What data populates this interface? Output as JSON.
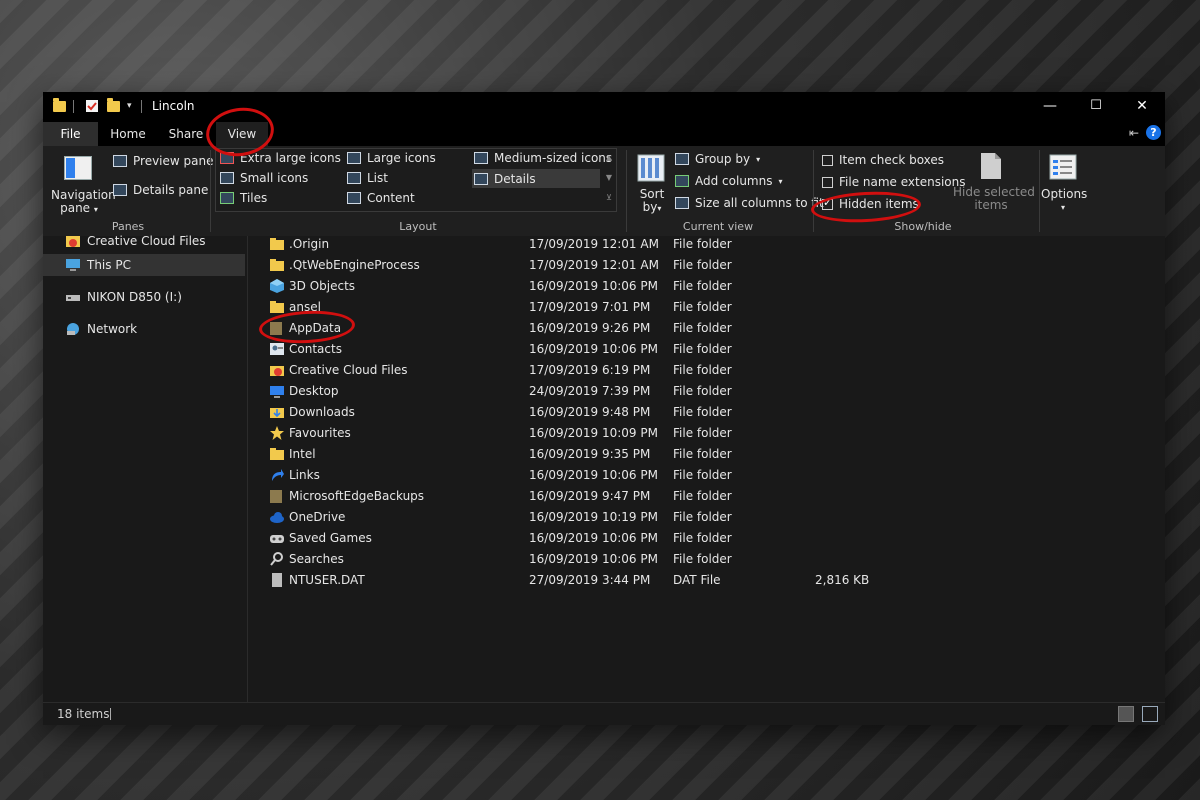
{
  "window": {
    "title": "Lincoln",
    "controls": {
      "minimize": "—",
      "maximize": "☐",
      "close": "✕"
    }
  },
  "tabs": [
    {
      "label": "File"
    },
    {
      "label": "Home"
    },
    {
      "label": "Share"
    },
    {
      "label": "View"
    }
  ],
  "ribbon": {
    "panes": {
      "navigation_pane": "Navigation",
      "navigation_pane_2": "pane",
      "preview_pane": "Preview pane",
      "details_pane": "Details pane",
      "group_label": "Panes"
    },
    "layout": {
      "items": [
        "Extra large icons",
        "Large icons",
        "Medium-sized icons",
        "Small icons",
        "List",
        "Details",
        "Tiles",
        "Content"
      ],
      "selected": "Details",
      "group_label": "Layout"
    },
    "current_view": {
      "sort_by": "Sort",
      "sort_by_2": "by",
      "group_by": "Group by",
      "add_columns": "Add columns",
      "size_all": "Size all columns to fit",
      "group_label": "Current view"
    },
    "show_hide": {
      "item_check_boxes": "Item check boxes",
      "file_name_extensions": "File name extensions",
      "hidden_items": "Hidden items",
      "hide_selected": "Hide selected",
      "hide_selected_2": "items",
      "group_label": "Show/hide"
    },
    "options": {
      "label": "Options"
    }
  },
  "nav": [
    {
      "label": "Creative Cloud Files"
    },
    {
      "label": "This PC"
    },
    {
      "label": "NIKON D850 (I:)"
    },
    {
      "label": "Network"
    }
  ],
  "files": [
    {
      "name": ".Origin",
      "date": "17/09/2019 12:01 AM",
      "type": "File folder",
      "size": ""
    },
    {
      "name": ".QtWebEngineProcess",
      "date": "17/09/2019 12:01 AM",
      "type": "File folder",
      "size": ""
    },
    {
      "name": "3D Objects",
      "date": "16/09/2019 10:06 PM",
      "type": "File folder",
      "size": ""
    },
    {
      "name": "ansel",
      "date": "17/09/2019 7:01 PM",
      "type": "File folder",
      "size": ""
    },
    {
      "name": "AppData",
      "date": "16/09/2019 9:26 PM",
      "type": "File folder",
      "size": ""
    },
    {
      "name": "Contacts",
      "date": "16/09/2019 10:06 PM",
      "type": "File folder",
      "size": ""
    },
    {
      "name": "Creative Cloud Files",
      "date": "17/09/2019 6:19 PM",
      "type": "File folder",
      "size": ""
    },
    {
      "name": "Desktop",
      "date": "24/09/2019 7:39 PM",
      "type": "File folder",
      "size": ""
    },
    {
      "name": "Downloads",
      "date": "16/09/2019 9:48 PM",
      "type": "File folder",
      "size": ""
    },
    {
      "name": "Favourites",
      "date": "16/09/2019 10:09 PM",
      "type": "File folder",
      "size": ""
    },
    {
      "name": "Intel",
      "date": "16/09/2019 9:35 PM",
      "type": "File folder",
      "size": ""
    },
    {
      "name": "Links",
      "date": "16/09/2019 10:06 PM",
      "type": "File folder",
      "size": ""
    },
    {
      "name": "MicrosoftEdgeBackups",
      "date": "16/09/2019 9:47 PM",
      "type": "File folder",
      "size": ""
    },
    {
      "name": "OneDrive",
      "date": "16/09/2019 10:19 PM",
      "type": "File folder",
      "size": ""
    },
    {
      "name": "Saved Games",
      "date": "16/09/2019 10:06 PM",
      "type": "File folder",
      "size": ""
    },
    {
      "name": "Searches",
      "date": "16/09/2019 10:06 PM",
      "type": "File folder",
      "size": ""
    },
    {
      "name": "NTUSER.DAT",
      "date": "27/09/2019 3:44 PM",
      "type": "DAT File",
      "size": "2,816 KB"
    }
  ],
  "status": {
    "count": "18 items"
  },
  "colors": {
    "annotation": "#d10f0f",
    "folder": "#f2c94c",
    "hidden_folder": "#8c7a4e",
    "accent": "#1a73e8"
  }
}
